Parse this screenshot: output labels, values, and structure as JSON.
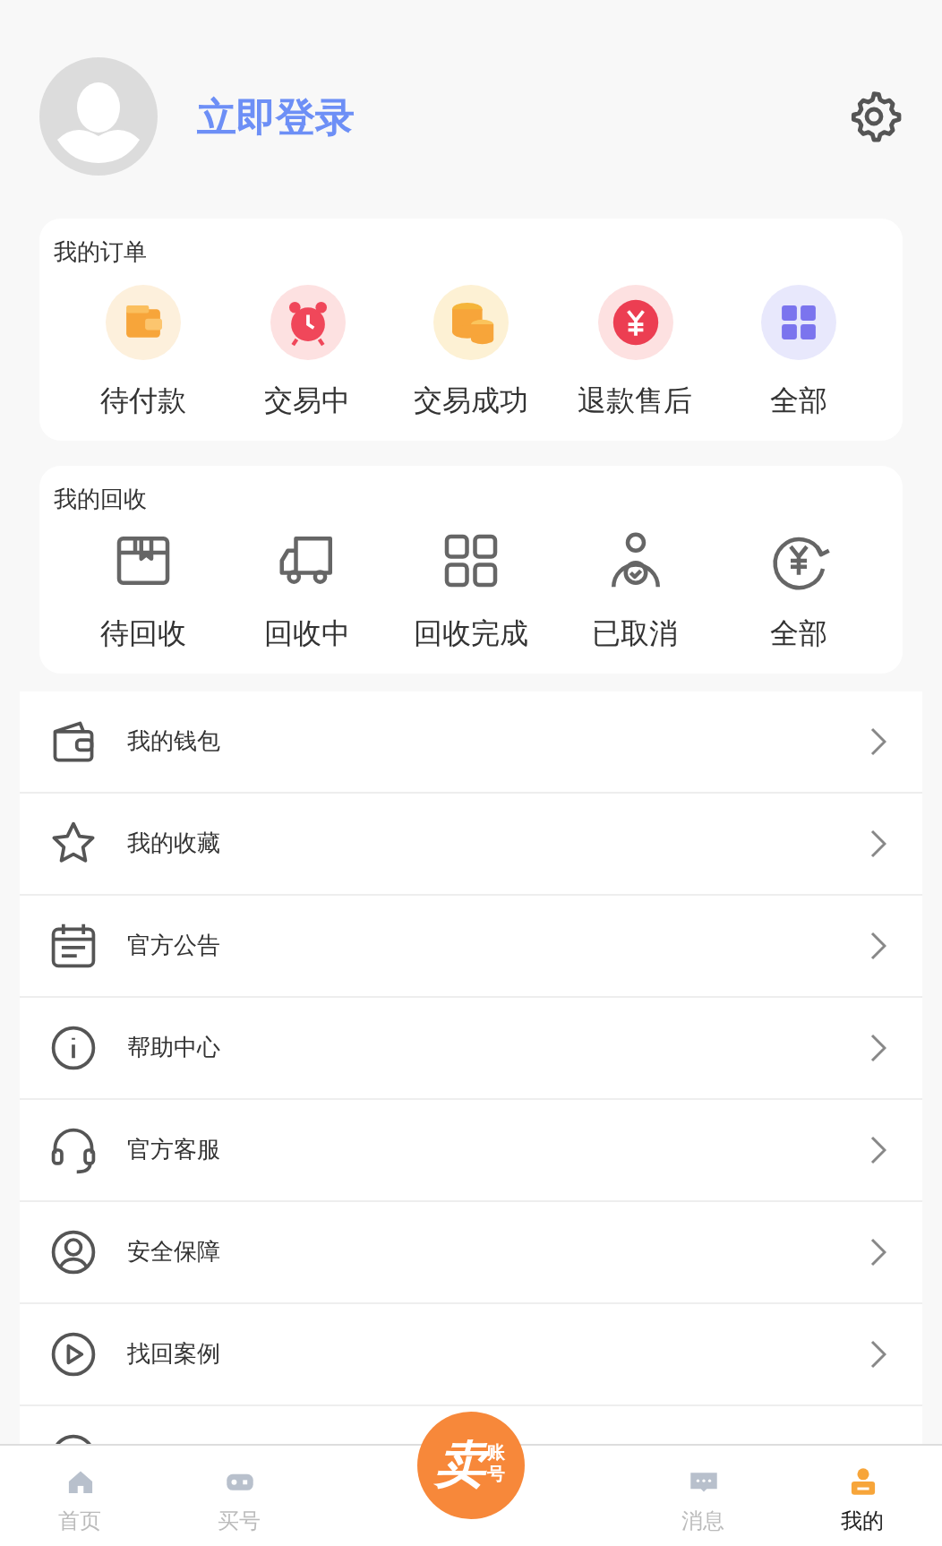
{
  "header": {
    "login_label": "立即登录"
  },
  "orders": {
    "title": "我的订单",
    "items": [
      {
        "label": "待付款"
      },
      {
        "label": "交易中"
      },
      {
        "label": "交易成功"
      },
      {
        "label": "退款售后"
      },
      {
        "label": "全部"
      }
    ]
  },
  "recycle": {
    "title": "我的回收",
    "items": [
      {
        "label": "待回收"
      },
      {
        "label": "回收中"
      },
      {
        "label": "回收完成"
      },
      {
        "label": "已取消"
      },
      {
        "label": "全部"
      }
    ]
  },
  "menu": [
    {
      "label": "我的钱包"
    },
    {
      "label": "我的收藏"
    },
    {
      "label": "官方公告"
    },
    {
      "label": "帮助中心"
    },
    {
      "label": "官方客服"
    },
    {
      "label": "安全保障"
    },
    {
      "label": "找回案例"
    }
  ],
  "tab_bar": [
    {
      "label": "首页",
      "selected": false
    },
    {
      "label": "买号",
      "selected": false
    },
    {
      "label": "消息",
      "selected": false
    },
    {
      "label": "我的",
      "selected": true
    }
  ],
  "center_button": {
    "main": "卖",
    "side": "账号"
  }
}
